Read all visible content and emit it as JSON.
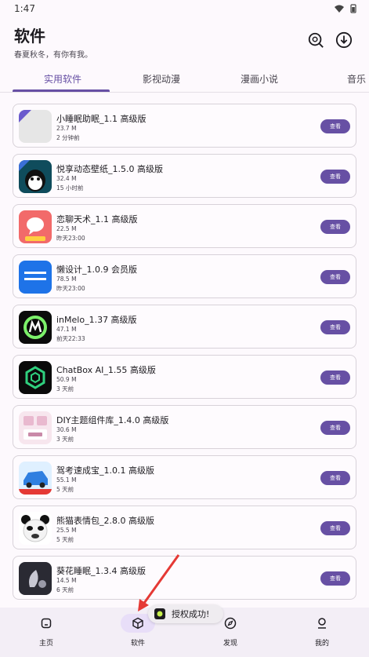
{
  "status": {
    "time": "1:47"
  },
  "header": {
    "title": "软件",
    "subtitle": "春夏秋冬，有你有我。"
  },
  "tabs": [
    {
      "label": "实用软件",
      "active": true
    },
    {
      "label": "影视动漫",
      "active": false
    },
    {
      "label": "漫画小说",
      "active": false
    },
    {
      "label": "音乐",
      "active": false
    }
  ],
  "apps": [
    {
      "name": "小睡眠助眠_1.1 高级版",
      "size": "23.7 M",
      "time": "2 分钟前",
      "action": "查看",
      "icon": "sleep-app-icon"
    },
    {
      "name": "悦享动态壁纸_1.5.0 高级版",
      "size": "32.4 M",
      "time": "15 小时前",
      "action": "查看",
      "icon": "penguin-wallpaper-icon"
    },
    {
      "name": "恋聊天术_1.1 高级版",
      "size": "22.5 M",
      "time": "昨天23:00",
      "action": "查看",
      "icon": "chat-bubble-icon"
    },
    {
      "name": "懒设计_1.0.9 会员版",
      "size": "78.5 M",
      "time": "昨天23:00",
      "action": "查看",
      "icon": "fotor-icon"
    },
    {
      "name": "inMelo_1.37 高级版",
      "size": "47.1 M",
      "time": "前天22:33",
      "action": "查看",
      "icon": "inmelo-icon"
    },
    {
      "name": "ChatBox AI_1.55 高级版",
      "size": "50.9 M",
      "time": "3 天前",
      "action": "查看",
      "icon": "chatbox-hexagon-icon"
    },
    {
      "name": "DIY主题组件库_1.4.0 高级版",
      "size": "30.6 M",
      "time": "3 天前",
      "action": "查看",
      "icon": "widget-clock-icon"
    },
    {
      "name": "驾考速成宝_1.0.1 高级版",
      "size": "55.1 M",
      "time": "5 天前",
      "action": "查看",
      "icon": "car-icon"
    },
    {
      "name": "熊猫表情包_2.8.0 高级版",
      "size": "25.5 M",
      "time": "5 天前",
      "action": "查看",
      "icon": "panda-face-icon"
    },
    {
      "name": "葵花睡眠_1.3.4 高级版",
      "size": "14.5 M",
      "time": "6 天前",
      "action": "查看",
      "icon": "moon-sleep-icon"
    }
  ],
  "toast": {
    "text": "授权成功!"
  },
  "nav": [
    {
      "label": "主页",
      "icon": "home-icon",
      "active": false
    },
    {
      "label": "软件",
      "icon": "cube-icon",
      "active": true
    },
    {
      "label": "发现",
      "icon": "compass-icon",
      "active": false
    },
    {
      "label": "我的",
      "icon": "person-icon",
      "active": false
    }
  ],
  "colors": {
    "accent": "#6750a4",
    "background": "#fdf9fd",
    "nav_bg": "#f3eef6",
    "arrow": "#e53935"
  }
}
